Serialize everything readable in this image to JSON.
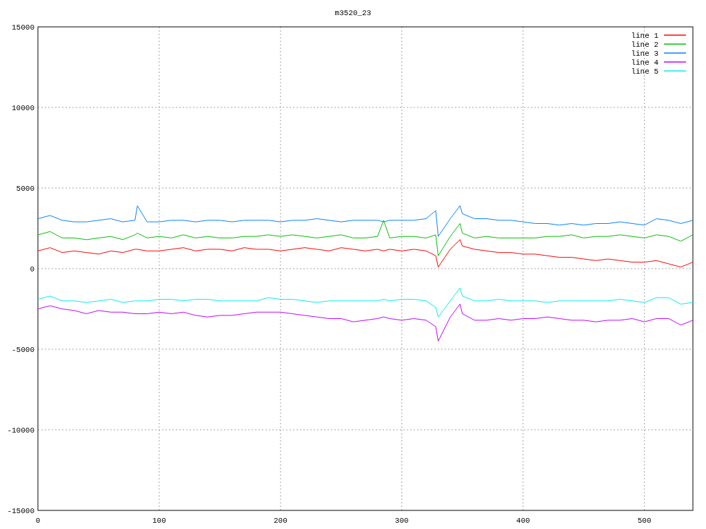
{
  "plot": {
    "chart_data": {
      "type": "line",
      "title": "m3520_23",
      "grid": true,
      "legend": true,
      "xlim": [
        0,
        540
      ],
      "ylim": [
        -15000,
        15000
      ],
      "xticks": [
        0,
        100,
        200,
        300,
        400,
        500
      ],
      "yticks": [
        -15000,
        -10000,
        -5000,
        0,
        5000,
        10000,
        15000
      ],
      "x": [
        0,
        10,
        20,
        30,
        40,
        50,
        60,
        70,
        80,
        82,
        90,
        100,
        110,
        120,
        130,
        140,
        150,
        160,
        170,
        180,
        190,
        200,
        210,
        220,
        230,
        240,
        250,
        260,
        270,
        280,
        285,
        290,
        300,
        310,
        320,
        328,
        330,
        340,
        348,
        350,
        360,
        370,
        380,
        390,
        400,
        410,
        420,
        430,
        440,
        450,
        460,
        470,
        480,
        490,
        500,
        510,
        520,
        530,
        540
      ],
      "series": [
        {
          "name": "line 1",
          "color": "#ff0000",
          "values": [
            1100,
            1300,
            1000,
            1100,
            1000,
            900,
            1100,
            1000,
            1200,
            1200,
            1100,
            1100,
            1200,
            1300,
            1100,
            1200,
            1200,
            1100,
            1300,
            1200,
            1200,
            1100,
            1200,
            1300,
            1200,
            1100,
            1300,
            1200,
            1100,
            1200,
            1100,
            1200,
            1100,
            1200,
            1100,
            800,
            100,
            1200,
            1800,
            1400,
            1200,
            1100,
            1000,
            1000,
            900,
            900,
            800,
            700,
            700,
            600,
            500,
            600,
            500,
            400,
            400,
            500,
            300,
            100,
            400
          ]
        },
        {
          "name": "line 2",
          "color": "#00c000",
          "values": [
            2100,
            2300,
            1900,
            1900,
            1800,
            1900,
            2000,
            1800,
            2100,
            2200,
            1900,
            2000,
            1900,
            2100,
            1900,
            2000,
            1900,
            1900,
            2000,
            2000,
            2100,
            2000,
            2100,
            2000,
            1900,
            2000,
            2100,
            1900,
            1900,
            2000,
            3000,
            1900,
            2000,
            2000,
            1900,
            2100,
            800,
            2000,
            2800,
            2200,
            1900,
            2000,
            1900,
            1900,
            1900,
            1900,
            2000,
            2000,
            2100,
            1900,
            2000,
            2000,
            2100,
            2000,
            1900,
            2100,
            2000,
            1700,
            2100
          ]
        },
        {
          "name": "line 3",
          "color": "#0080ff",
          "values": [
            3100,
            3300,
            3000,
            2900,
            2900,
            3000,
            3100,
            2900,
            3000,
            3900,
            2900,
            2900,
            3000,
            3000,
            2900,
            3000,
            3000,
            2900,
            3000,
            3000,
            3000,
            2900,
            3000,
            3000,
            3100,
            3000,
            2900,
            3000,
            3000,
            3000,
            2900,
            3000,
            3000,
            3000,
            3100,
            3600,
            2000,
            3100,
            3900,
            3400,
            3100,
            3100,
            3000,
            3000,
            2900,
            2800,
            2800,
            2700,
            2800,
            2700,
            2800,
            2800,
            2900,
            2800,
            2700,
            3100,
            3000,
            2800,
            3000
          ]
        },
        {
          "name": "line 4",
          "color": "#c000ff",
          "values": [
            -2500,
            -2300,
            -2500,
            -2600,
            -2800,
            -2600,
            -2700,
            -2700,
            -2800,
            -2800,
            -2800,
            -2700,
            -2800,
            -2700,
            -2900,
            -3000,
            -2900,
            -2900,
            -2800,
            -2700,
            -2700,
            -2700,
            -2800,
            -2900,
            -3000,
            -3100,
            -3100,
            -3300,
            -3200,
            -3100,
            -3000,
            -3100,
            -3200,
            -3100,
            -3200,
            -3600,
            -4500,
            -3000,
            -2200,
            -2800,
            -3200,
            -3200,
            -3100,
            -3200,
            -3100,
            -3100,
            -3000,
            -3100,
            -3200,
            -3200,
            -3300,
            -3200,
            -3200,
            -3100,
            -3300,
            -3100,
            -3100,
            -3500,
            -3200
          ]
        },
        {
          "name": "line 5",
          "color": "#00eeee",
          "values": [
            -1900,
            -1700,
            -2000,
            -2000,
            -2100,
            -2000,
            -1900,
            -2100,
            -2000,
            -2000,
            -2000,
            -1900,
            -1900,
            -2000,
            -1900,
            -1900,
            -2000,
            -2000,
            -2000,
            -2000,
            -1800,
            -1900,
            -1900,
            -2000,
            -2100,
            -2000,
            -2000,
            -2000,
            -2000,
            -2000,
            -1900,
            -2000,
            -1900,
            -1900,
            -2000,
            -2400,
            -3000,
            -2000,
            -1200,
            -1700,
            -2000,
            -2000,
            -1900,
            -2000,
            -2000,
            -2000,
            -2100,
            -2000,
            -2000,
            -2000,
            -2000,
            -2000,
            -1900,
            -2000,
            -2100,
            -1800,
            -1800,
            -2200,
            -2100
          ]
        }
      ]
    }
  }
}
